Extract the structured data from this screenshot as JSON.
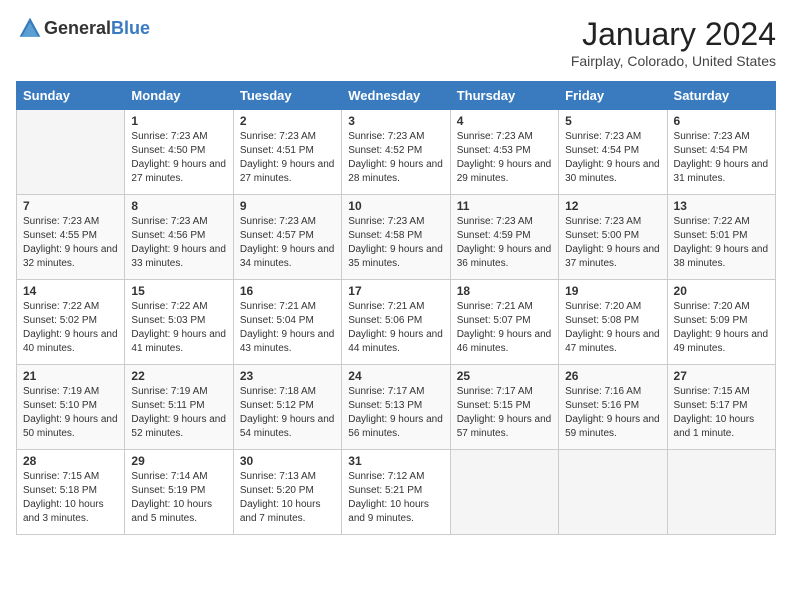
{
  "header": {
    "logo_general": "General",
    "logo_blue": "Blue",
    "month": "January 2024",
    "location": "Fairplay, Colorado, United States"
  },
  "days_of_week": [
    "Sunday",
    "Monday",
    "Tuesday",
    "Wednesday",
    "Thursday",
    "Friday",
    "Saturday"
  ],
  "weeks": [
    [
      {
        "day": "",
        "sunrise": "",
        "sunset": "",
        "daylight": ""
      },
      {
        "day": "1",
        "sunrise": "Sunrise: 7:23 AM",
        "sunset": "Sunset: 4:50 PM",
        "daylight": "Daylight: 9 hours and 27 minutes."
      },
      {
        "day": "2",
        "sunrise": "Sunrise: 7:23 AM",
        "sunset": "Sunset: 4:51 PM",
        "daylight": "Daylight: 9 hours and 27 minutes."
      },
      {
        "day": "3",
        "sunrise": "Sunrise: 7:23 AM",
        "sunset": "Sunset: 4:52 PM",
        "daylight": "Daylight: 9 hours and 28 minutes."
      },
      {
        "day": "4",
        "sunrise": "Sunrise: 7:23 AM",
        "sunset": "Sunset: 4:53 PM",
        "daylight": "Daylight: 9 hours and 29 minutes."
      },
      {
        "day": "5",
        "sunrise": "Sunrise: 7:23 AM",
        "sunset": "Sunset: 4:54 PM",
        "daylight": "Daylight: 9 hours and 30 minutes."
      },
      {
        "day": "6",
        "sunrise": "Sunrise: 7:23 AM",
        "sunset": "Sunset: 4:54 PM",
        "daylight": "Daylight: 9 hours and 31 minutes."
      }
    ],
    [
      {
        "day": "7",
        "sunrise": "Sunrise: 7:23 AM",
        "sunset": "Sunset: 4:55 PM",
        "daylight": "Daylight: 9 hours and 32 minutes."
      },
      {
        "day": "8",
        "sunrise": "Sunrise: 7:23 AM",
        "sunset": "Sunset: 4:56 PM",
        "daylight": "Daylight: 9 hours and 33 minutes."
      },
      {
        "day": "9",
        "sunrise": "Sunrise: 7:23 AM",
        "sunset": "Sunset: 4:57 PM",
        "daylight": "Daylight: 9 hours and 34 minutes."
      },
      {
        "day": "10",
        "sunrise": "Sunrise: 7:23 AM",
        "sunset": "Sunset: 4:58 PM",
        "daylight": "Daylight: 9 hours and 35 minutes."
      },
      {
        "day": "11",
        "sunrise": "Sunrise: 7:23 AM",
        "sunset": "Sunset: 4:59 PM",
        "daylight": "Daylight: 9 hours and 36 minutes."
      },
      {
        "day": "12",
        "sunrise": "Sunrise: 7:23 AM",
        "sunset": "Sunset: 5:00 PM",
        "daylight": "Daylight: 9 hours and 37 minutes."
      },
      {
        "day": "13",
        "sunrise": "Sunrise: 7:22 AM",
        "sunset": "Sunset: 5:01 PM",
        "daylight": "Daylight: 9 hours and 38 minutes."
      }
    ],
    [
      {
        "day": "14",
        "sunrise": "Sunrise: 7:22 AM",
        "sunset": "Sunset: 5:02 PM",
        "daylight": "Daylight: 9 hours and 40 minutes."
      },
      {
        "day": "15",
        "sunrise": "Sunrise: 7:22 AM",
        "sunset": "Sunset: 5:03 PM",
        "daylight": "Daylight: 9 hours and 41 minutes."
      },
      {
        "day": "16",
        "sunrise": "Sunrise: 7:21 AM",
        "sunset": "Sunset: 5:04 PM",
        "daylight": "Daylight: 9 hours and 43 minutes."
      },
      {
        "day": "17",
        "sunrise": "Sunrise: 7:21 AM",
        "sunset": "Sunset: 5:06 PM",
        "daylight": "Daylight: 9 hours and 44 minutes."
      },
      {
        "day": "18",
        "sunrise": "Sunrise: 7:21 AM",
        "sunset": "Sunset: 5:07 PM",
        "daylight": "Daylight: 9 hours and 46 minutes."
      },
      {
        "day": "19",
        "sunrise": "Sunrise: 7:20 AM",
        "sunset": "Sunset: 5:08 PM",
        "daylight": "Daylight: 9 hours and 47 minutes."
      },
      {
        "day": "20",
        "sunrise": "Sunrise: 7:20 AM",
        "sunset": "Sunset: 5:09 PM",
        "daylight": "Daylight: 9 hours and 49 minutes."
      }
    ],
    [
      {
        "day": "21",
        "sunrise": "Sunrise: 7:19 AM",
        "sunset": "Sunset: 5:10 PM",
        "daylight": "Daylight: 9 hours and 50 minutes."
      },
      {
        "day": "22",
        "sunrise": "Sunrise: 7:19 AM",
        "sunset": "Sunset: 5:11 PM",
        "daylight": "Daylight: 9 hours and 52 minutes."
      },
      {
        "day": "23",
        "sunrise": "Sunrise: 7:18 AM",
        "sunset": "Sunset: 5:12 PM",
        "daylight": "Daylight: 9 hours and 54 minutes."
      },
      {
        "day": "24",
        "sunrise": "Sunrise: 7:17 AM",
        "sunset": "Sunset: 5:13 PM",
        "daylight": "Daylight: 9 hours and 56 minutes."
      },
      {
        "day": "25",
        "sunrise": "Sunrise: 7:17 AM",
        "sunset": "Sunset: 5:15 PM",
        "daylight": "Daylight: 9 hours and 57 minutes."
      },
      {
        "day": "26",
        "sunrise": "Sunrise: 7:16 AM",
        "sunset": "Sunset: 5:16 PM",
        "daylight": "Daylight: 9 hours and 59 minutes."
      },
      {
        "day": "27",
        "sunrise": "Sunrise: 7:15 AM",
        "sunset": "Sunset: 5:17 PM",
        "daylight": "Daylight: 10 hours and 1 minute."
      }
    ],
    [
      {
        "day": "28",
        "sunrise": "Sunrise: 7:15 AM",
        "sunset": "Sunset: 5:18 PM",
        "daylight": "Daylight: 10 hours and 3 minutes."
      },
      {
        "day": "29",
        "sunrise": "Sunrise: 7:14 AM",
        "sunset": "Sunset: 5:19 PM",
        "daylight": "Daylight: 10 hours and 5 minutes."
      },
      {
        "day": "30",
        "sunrise": "Sunrise: 7:13 AM",
        "sunset": "Sunset: 5:20 PM",
        "daylight": "Daylight: 10 hours and 7 minutes."
      },
      {
        "day": "31",
        "sunrise": "Sunrise: 7:12 AM",
        "sunset": "Sunset: 5:21 PM",
        "daylight": "Daylight: 10 hours and 9 minutes."
      },
      {
        "day": "",
        "sunrise": "",
        "sunset": "",
        "daylight": ""
      },
      {
        "day": "",
        "sunrise": "",
        "sunset": "",
        "daylight": ""
      },
      {
        "day": "",
        "sunrise": "",
        "sunset": "",
        "daylight": ""
      }
    ]
  ]
}
